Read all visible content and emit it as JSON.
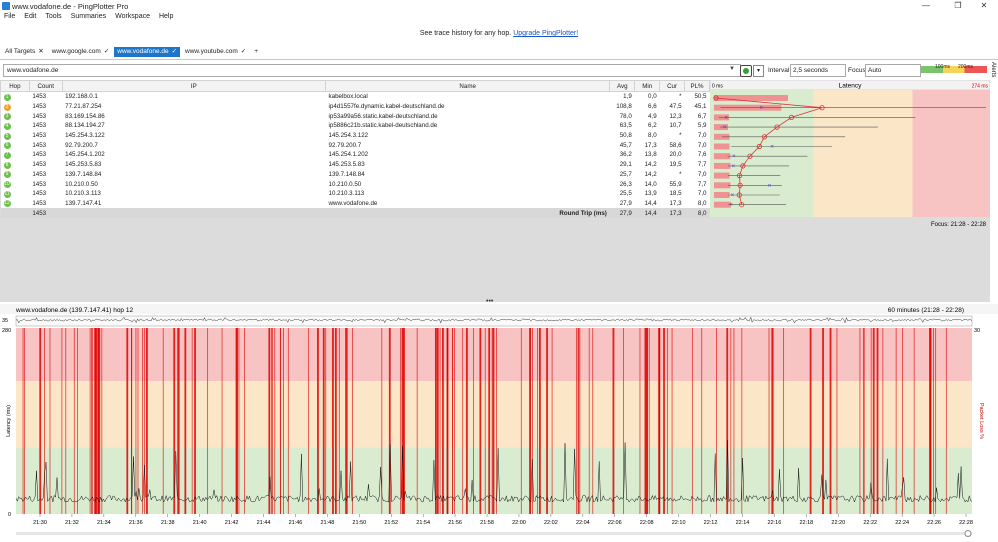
{
  "window": {
    "title": "www.vodafone.de - PingPlotter Pro"
  },
  "menu": [
    "File",
    "Edit",
    "Tools",
    "Summaries",
    "Workspace",
    "Help"
  ],
  "banner": {
    "text": "See trace history for any hop.",
    "link": "Upgrade PingPlotter!"
  },
  "tabs": [
    {
      "label": "All Targets",
      "suffix": "✕"
    },
    {
      "label": "www.google.com",
      "suffix": "✓"
    },
    {
      "label": "www.vodafone.de",
      "suffix": "✓"
    },
    {
      "label": "www.youtube.com",
      "suffix": "✓"
    },
    {
      "label": "+",
      "suffix": ""
    }
  ],
  "toolbar": {
    "address": "www.vodafone.de",
    "interval_label": "Interval",
    "interval_value": "2,5 seconds",
    "focus_label": "Focus",
    "focus_value": "Auto",
    "legend_100": "100ms",
    "legend_200": "200ms",
    "alerts": "Alerts"
  },
  "table": {
    "headers": [
      "Hop",
      "Count",
      "IP",
      "Name",
      "Avg",
      "Min",
      "Cur",
      "PL%"
    ],
    "latency_header": "Latency",
    "scale_min": "0 ms",
    "scale_max": "274 ms",
    "rows": [
      {
        "hop": "1",
        "count": "1453",
        "ip": "192.168.0.1",
        "name": "kabelbox.local",
        "avg": "1,9",
        "min": "0,0",
        "cur": "*",
        "pl": "50,5"
      },
      {
        "hop": "2",
        "count": "1453",
        "ip": "77.21.87.254",
        "name": "ip4d1557fe.dynamic.kabel-deutschland.de",
        "avg": "108,8",
        "min": "6,6",
        "cur": "47,5",
        "pl": "45,1"
      },
      {
        "hop": "3",
        "count": "1453",
        "ip": "83.169.154.86",
        "name": "ip53a99a56.static.kabel-deutschland.de",
        "avg": "78,0",
        "min": "4,9",
        "cur": "12,3",
        "pl": "6,7"
      },
      {
        "hop": "4",
        "count": "1453",
        "ip": "88.134.194.27",
        "name": "ip5886c21b.static.kabel-deutschland.de",
        "avg": "63,5",
        "min": "6,2",
        "cur": "10,7",
        "pl": "5,9"
      },
      {
        "hop": "5",
        "count": "1453",
        "ip": "145.254.3.122",
        "name": "145.254.3.122",
        "avg": "50,8",
        "min": "8,0",
        "cur": "*",
        "pl": "7,0"
      },
      {
        "hop": "6",
        "count": "1453",
        "ip": "92.79.200.7",
        "name": "92.79.200.7",
        "avg": "45,7",
        "min": "17,3",
        "cur": "58,6",
        "pl": "7,0"
      },
      {
        "hop": "7",
        "count": "1453",
        "ip": "145.254.1.202",
        "name": "145.254.1.202",
        "avg": "36,2",
        "min": "13,8",
        "cur": "20,0",
        "pl": "7,6"
      },
      {
        "hop": "8",
        "count": "1453",
        "ip": "145.253.5.83",
        "name": "145.253.5.83",
        "avg": "29,1",
        "min": "14,2",
        "cur": "19,5",
        "pl": "7,7"
      },
      {
        "hop": "9",
        "count": "1453",
        "ip": "139.7.148.84",
        "name": "139.7.148.84",
        "avg": "25,7",
        "min": "14,2",
        "cur": "*",
        "pl": "7,0"
      },
      {
        "hop": "10",
        "count": "1453",
        "ip": "10.210.0.50",
        "name": "10.210.0.50",
        "avg": "26,3",
        "min": "14,0",
        "cur": "55,9",
        "pl": "7,7"
      },
      {
        "hop": "11",
        "count": "1453",
        "ip": "10.210.3.113",
        "name": "10.210.3.113",
        "avg": "25,5",
        "min": "13,9",
        "cur": "18,5",
        "pl": "7,0"
      },
      {
        "hop": "12",
        "count": "1453",
        "ip": "139.7.147.41",
        "name": "www.vodafone.de",
        "avg": "27,9",
        "min": "14,4",
        "cur": "17,3",
        "pl": "8,0"
      }
    ],
    "summary": {
      "count": "1453",
      "label": "Round Trip (ms)",
      "avg": "27,9",
      "min": "14,4",
      "cur": "17,3",
      "pl": "8,0"
    },
    "focus_text": "Focus: 21:28 - 22:28"
  },
  "history": {
    "title": "www.vodafone.de (139.7.147.41) hop 12",
    "range": "60 minutes (21:28 - 22:28)",
    "mini_label": "35",
    "mini_right": "30",
    "y_top": "280",
    "y_bottom": "0",
    "ylabel": "Latency (ms)",
    "ylabel_right": "Packet Loss %",
    "xticks": [
      "21:30",
      "21:32",
      "21:34",
      "21:36",
      "21:38",
      "21:40",
      "21:42",
      "21:44",
      "21:46",
      "21:48",
      "21:50",
      "21:52",
      "21:54",
      "21:56",
      "21:58",
      "22:00",
      "22:02",
      "22:04",
      "22:06",
      "22:08",
      "22:10",
      "22:12",
      "22:14",
      "22:16",
      "22:18",
      "22:20",
      "22:22",
      "22:24",
      "22:26",
      "22:28"
    ]
  },
  "colors": {
    "good": "#d9ecd0",
    "warn": "#fbe6c8",
    "bad": "#f7c3c3",
    "loss": "#e00000",
    "accent": "#1d76c7"
  }
}
